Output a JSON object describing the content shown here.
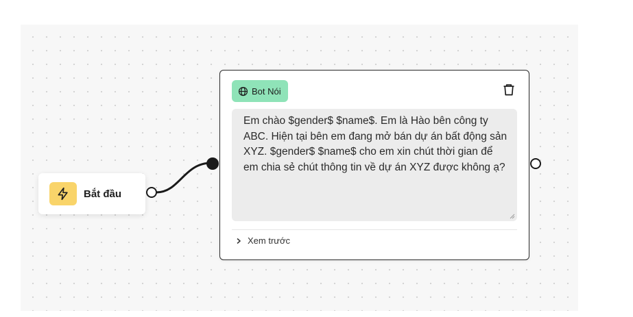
{
  "start_node": {
    "label": "Bắt đầu",
    "icon": "lightning-icon",
    "icon_bg": "#f9d46a"
  },
  "bot_node": {
    "badge_label": "Bot Nói",
    "badge_icon": "globe-icon",
    "badge_bg": "#8fe3b8",
    "delete_icon": "trash-icon",
    "message": "Em chào $gender$ $name$. Em là Hào bên công ty ABC. Hiện tại bên em đang mở bán dự án bất động sản XYZ. $gender$ $name$ cho em xin chút thời gian để em chia sẻ chút thông tin về dự án XYZ được không ạ?",
    "preview_label": "Xem trước",
    "preview_icon": "chevron-right-icon"
  },
  "colors": {
    "canvas_bg": "#f7f7f7",
    "edge": "#1a1a1a"
  }
}
